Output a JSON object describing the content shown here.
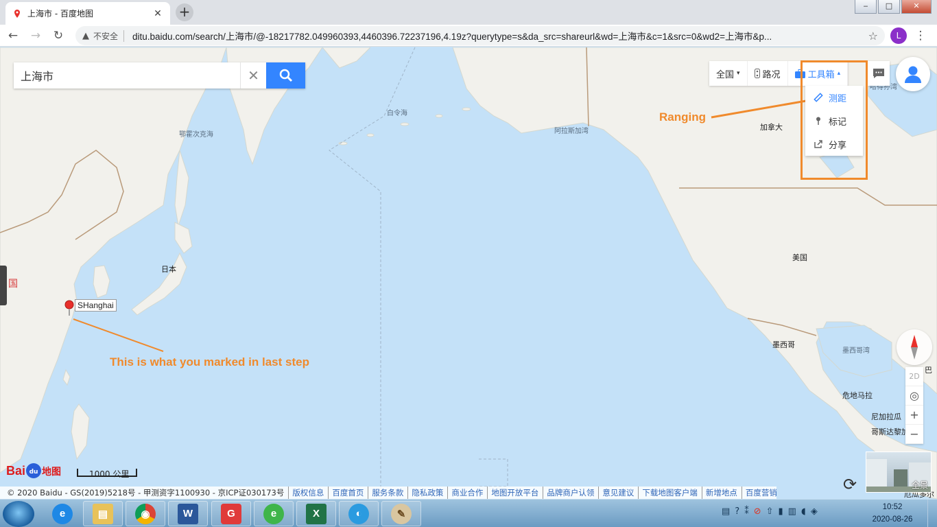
{
  "browser": {
    "tab_title": "上海市 - 百度地图",
    "tab_close": "✕",
    "new_tab": "+",
    "win_min": "‒",
    "win_max": "□",
    "win_close": "✕",
    "back": "←",
    "forward": "→",
    "reload": "↻",
    "security_icon": "▲",
    "security_text": "不安全",
    "url": "ditu.baidu.com/search/上海市/@-18217782.049960393,4460396.72237196,4.19z?querytype=s&da_src=shareurl&wd=上海市&c=1&src=0&wd2=上海市&p...",
    "star": "☆",
    "profile_initial": "L",
    "menu": "⋮"
  },
  "search": {
    "value": "上海市",
    "clear": "✕"
  },
  "map_controls": {
    "region": "全国",
    "traffic": "路况",
    "toolbox": "工具箱",
    "toolbox_menu": [
      {
        "label": "测距",
        "icon": "ruler-icon"
      },
      {
        "label": "标记",
        "icon": "pin-icon"
      },
      {
        "label": "分享",
        "icon": "share-icon"
      }
    ],
    "zoom_2d": "2D",
    "locate": "◎",
    "zoom_in": "+",
    "zoom_out": "−",
    "panorama": "全景"
  },
  "map_labels": {
    "bering_sea": "白令海",
    "okhotsk": "鄂霍次克海",
    "gulf_alaska": "阿拉斯加湾",
    "canada": "加拿大",
    "usa": "美国",
    "japan": "日本",
    "mexico": "墨西哥",
    "gulf_mexico": "墨西哥湾",
    "guatemala": "危地马拉",
    "china_edge": "国",
    "hudson_edge": "哈得孙湾",
    "cuba_edge": "巴",
    "nicaragua": "尼加拉瓜",
    "costa_rica": "哥斯达黎加",
    "ecuador_edge": "厄瓜多尔"
  },
  "marker": {
    "label": "SHanghai"
  },
  "annotations": {
    "ranging": "Ranging",
    "marked": "This is what you marked in last step"
  },
  "footer": {
    "logo_bai": "Bai",
    "logo_du": "du",
    "logo_map": "地图",
    "scale": "1000 公里",
    "copyright": "© 2020 Baidu - GS(2019)5218号 - 甲测资字1100930 - 京ICP证030173号",
    "links": [
      "版权信息",
      "百度首页",
      "服务条款",
      "隐私政策",
      "商业合作",
      "地图开放平台",
      "品牌商户认领",
      "意见建议",
      "下载地图客户端",
      "新增地点",
      "百度营销"
    ]
  },
  "taskbar": {
    "apps": [
      {
        "name": "ie",
        "icon": "e"
      },
      {
        "name": "explorer",
        "icon": "▤"
      },
      {
        "name": "chrome",
        "icon": "◉"
      },
      {
        "name": "word",
        "icon": "W"
      },
      {
        "name": "app-g",
        "icon": "G"
      },
      {
        "name": "app-e",
        "icon": "e"
      },
      {
        "name": "excel",
        "icon": "X"
      },
      {
        "name": "browser-blue",
        "icon": "◐"
      },
      {
        "name": "paint",
        "icon": "✎"
      }
    ],
    "time": "10:52",
    "date": "2020-08-26"
  },
  "colors": {
    "accent": "#3385ff",
    "annotation": "#f08a2c",
    "sea": "#c4e1f8",
    "land": "#f2f1ec"
  }
}
